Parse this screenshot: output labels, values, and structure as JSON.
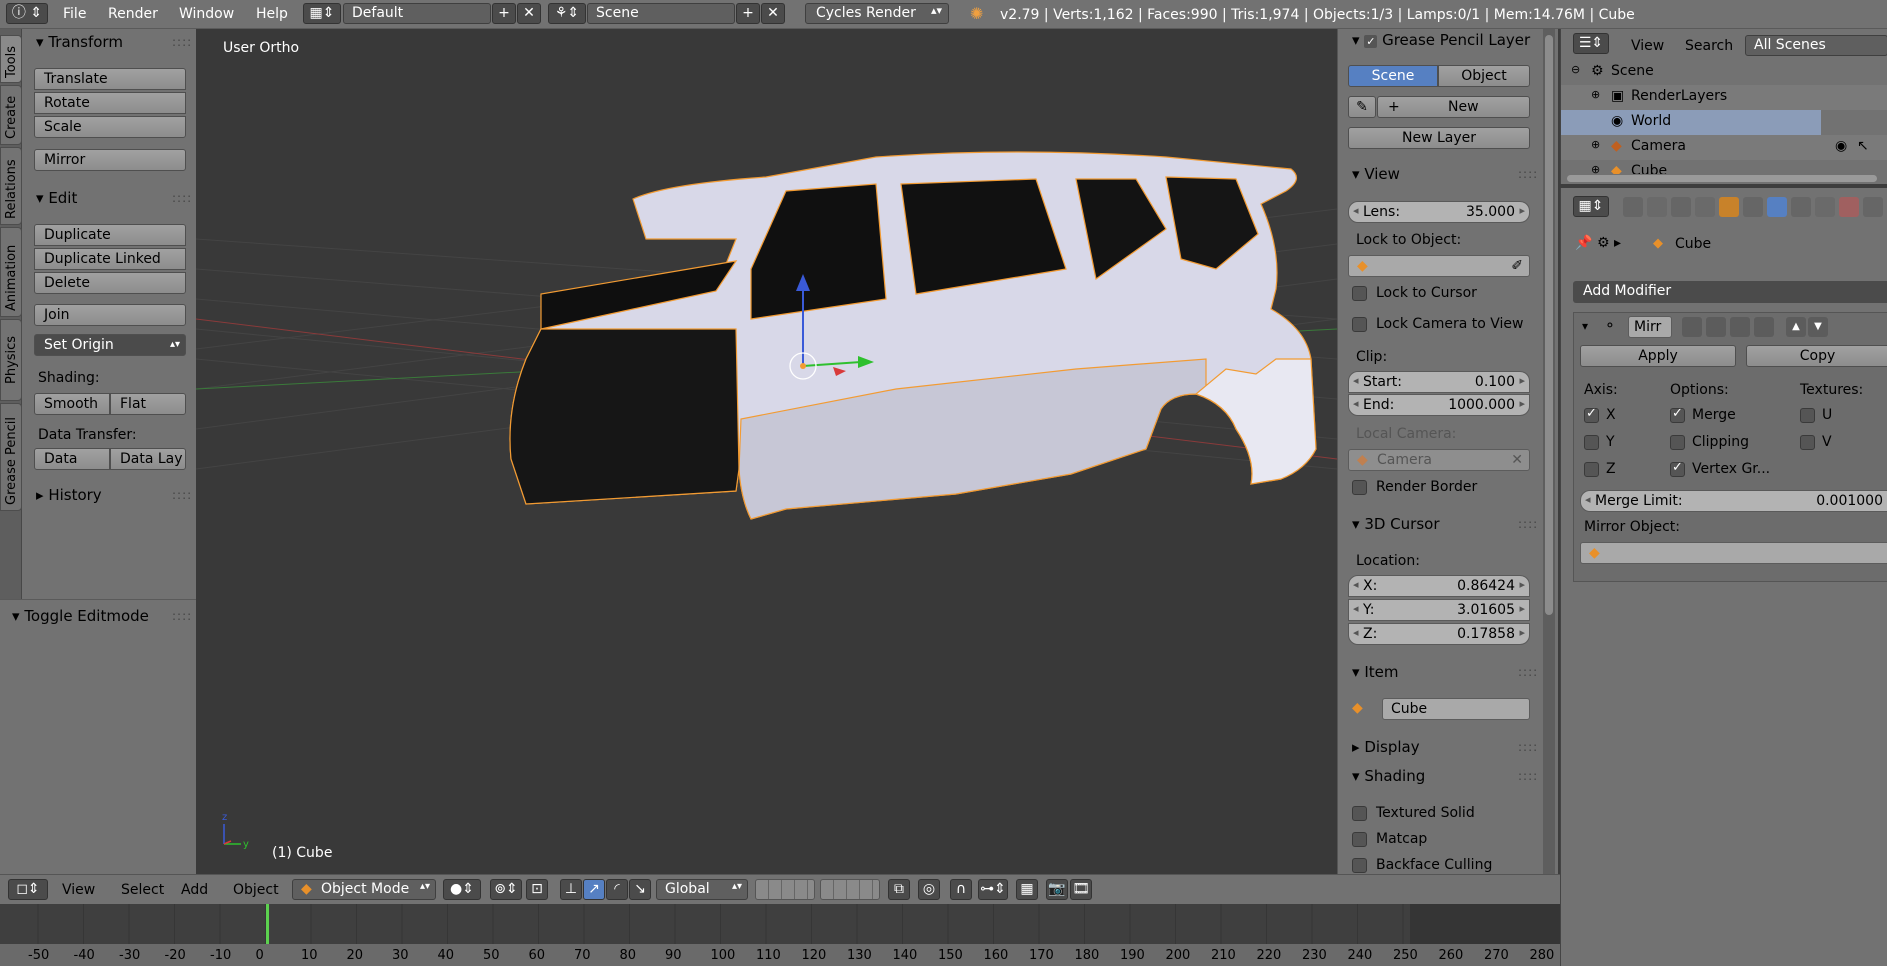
{
  "topbar": {
    "menus": [
      "File",
      "Render",
      "Window",
      "Help"
    ],
    "layout": "Default",
    "scene": "Scene",
    "engine": "Cycles Render",
    "stats": "v2.79 | Verts:1,162 | Faces:990 | Tris:1,974 | Objects:1/3 | Lamps:0/1 | Mem:14.76M | Cube"
  },
  "tabs": [
    "Tools",
    "Create",
    "Relations",
    "Animation",
    "Physics",
    "Grease Pencil"
  ],
  "shelf": {
    "transform": "Transform",
    "translate": "Translate",
    "rotate": "Rotate",
    "scale": "Scale",
    "mirror": "Mirror",
    "edit": "Edit",
    "duplicate": "Duplicate",
    "duplicate_linked": "Duplicate Linked",
    "delete": "Delete",
    "join": "Join",
    "set_origin": "Set Origin",
    "shading": "Shading:",
    "smooth": "Smooth",
    "flat": "Flat",
    "data_transfer": "Data Transfer:",
    "data": "Data",
    "data_lay": "Data Lay",
    "history": "History",
    "toggle_editmode": "Toggle Editmode"
  },
  "viewport": {
    "view_label": "User Ortho",
    "object_label": "(1) Cube"
  },
  "npanel": {
    "grease_pencil": "Grease Pencil Layer",
    "scene": "Scene",
    "object": "Object",
    "new": "New",
    "new_layer": "New Layer",
    "view": "View",
    "lens_label": "Lens:",
    "lens_value": "35.000",
    "lock_to_object": "Lock to Object:",
    "lock_to_cursor": "Lock to Cursor",
    "lock_camera": "Lock Camera to View",
    "clip": "Clip:",
    "start_label": "Start:",
    "start_value": "0.100",
    "end_label": "End:",
    "end_value": "1000.000",
    "local_camera": "Local Camera:",
    "camera": "Camera",
    "render_border": "Render Border",
    "cursor": "3D Cursor",
    "location": "Location:",
    "x_label": "X:",
    "x_value": "0.86424",
    "y_label": "Y:",
    "y_value": "3.01605",
    "z_label": "Z:",
    "z_value": "0.17858",
    "item": "Item",
    "item_name": "Cube",
    "display": "Display",
    "shading": "Shading",
    "textured_solid": "Textured Solid",
    "matcap": "Matcap",
    "backface": "Backface Culling"
  },
  "outliner": {
    "view": "View",
    "search": "Search",
    "all_scenes": "All Scenes",
    "rows": [
      "Scene",
      "RenderLayers",
      "World",
      "Camera",
      "Cube"
    ]
  },
  "props": {
    "breadcrumb_object": "Cube",
    "add_modifier": "Add Modifier",
    "modifier_name": "Mirr",
    "apply": "Apply",
    "copy": "Copy",
    "axis": "Axis:",
    "options": "Options:",
    "textures": "Textures:",
    "x": "X",
    "y": "Y",
    "z": "Z",
    "merge": "Merge",
    "clipping": "Clipping",
    "vertex_groups": "Vertex Gr...",
    "u": "U",
    "v": "V",
    "merge_limit_label": "Merge Limit:",
    "merge_limit_value": "0.001000",
    "mirror_object": "Mirror Object:"
  },
  "bottombar": {
    "menus": [
      "View",
      "Select",
      "Add",
      "Object"
    ],
    "mode": "Object Mode",
    "orientation": "Global"
  },
  "timeline": {
    "ticks": [
      "-50",
      "-40",
      "-30",
      "-20",
      "-10",
      "0",
      "10",
      "20",
      "30",
      "40",
      "50",
      "60",
      "70",
      "80",
      "90",
      "100",
      "110",
      "120",
      "130",
      "140",
      "150",
      "160",
      "170",
      "180",
      "190",
      "200",
      "210",
      "220",
      "230",
      "240",
      "250",
      "260",
      "270",
      "280"
    ],
    "current_frame": 0
  },
  "colors": {
    "accent": "#5680c2",
    "header": "#727272",
    "viewport": "#393939",
    "selection_outline": "#f29b33"
  }
}
